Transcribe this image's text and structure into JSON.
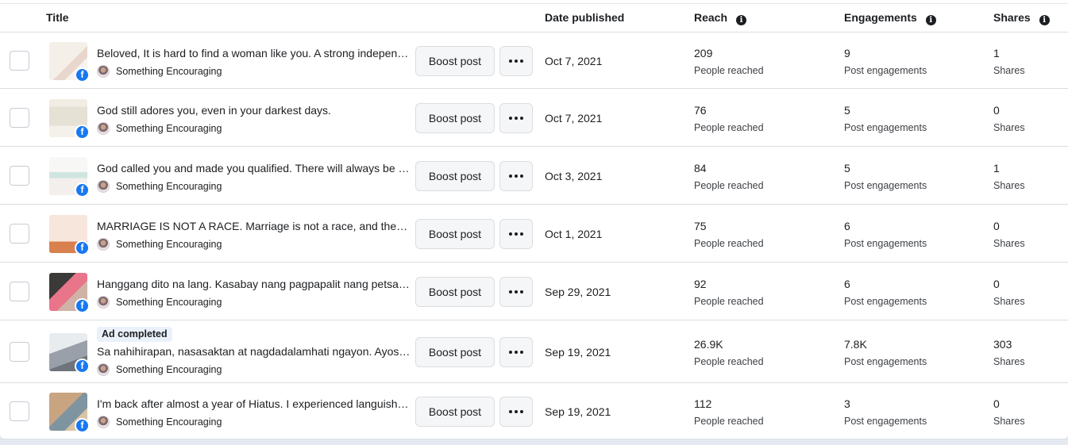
{
  "header": {
    "title": "Title",
    "date_published": "Date published",
    "reach": "Reach",
    "engagements": "Engagements",
    "shares": "Shares",
    "info_icon": "info-icon"
  },
  "labels": {
    "boost": "Boost post",
    "reach_label": "People reached",
    "engagement_label": "Post engagements",
    "shares_label": "Shares",
    "facebook_badge": "f"
  },
  "rows": [
    {
      "title": "Beloved, It is hard to find a woman like you. A strong independent",
      "page": "Something Encouraging",
      "date": "Oct 7, 2021",
      "reach": "209",
      "engagements": "9",
      "shares": "1",
      "badge": ""
    },
    {
      "title": "God still adores you, even in your darkest days.",
      "page": "Something Encouraging",
      "date": "Oct 7, 2021",
      "reach": "76",
      "engagements": "5",
      "shares": "0",
      "badge": ""
    },
    {
      "title": "God called you and made you qualified. There will always be a lot",
      "page": "Something Encouraging",
      "date": "Oct 3, 2021",
      "reach": "84",
      "engagements": "5",
      "shares": "1",
      "badge": ""
    },
    {
      "title": "MARRIAGE IS NOT A RACE. Marriage is not a race, and there's no",
      "page": "Something Encouraging",
      "date": "Oct 1, 2021",
      "reach": "75",
      "engagements": "6",
      "shares": "0",
      "badge": ""
    },
    {
      "title": "Hanggang dito na lang. Kasabay nang pagpapalit nang petsa ngayon",
      "page": "Something Encouraging",
      "date": "Sep 29, 2021",
      "reach": "92",
      "engagements": "6",
      "shares": "0",
      "badge": ""
    },
    {
      "title": "Sa nahihirapan, nasasaktan at nagdadalamhati ngayon. Ayos lang yan",
      "page": "Something Encouraging",
      "date": "Sep 19, 2021",
      "reach": "26.9K",
      "engagements": "7.8K",
      "shares": "303",
      "badge": "Ad completed"
    },
    {
      "title": "I'm back after almost a year of Hiatus. I experienced languishing",
      "page": "Something Encouraging",
      "date": "Sep 19, 2021",
      "reach": "112",
      "engagements": "3",
      "shares": "0",
      "badge": ""
    }
  ],
  "colors": {
    "facebook_blue": "#1877f2",
    "border": "#dadde1",
    "button_bg": "#f5f6f7",
    "badge_bg": "#ebf1fa"
  }
}
